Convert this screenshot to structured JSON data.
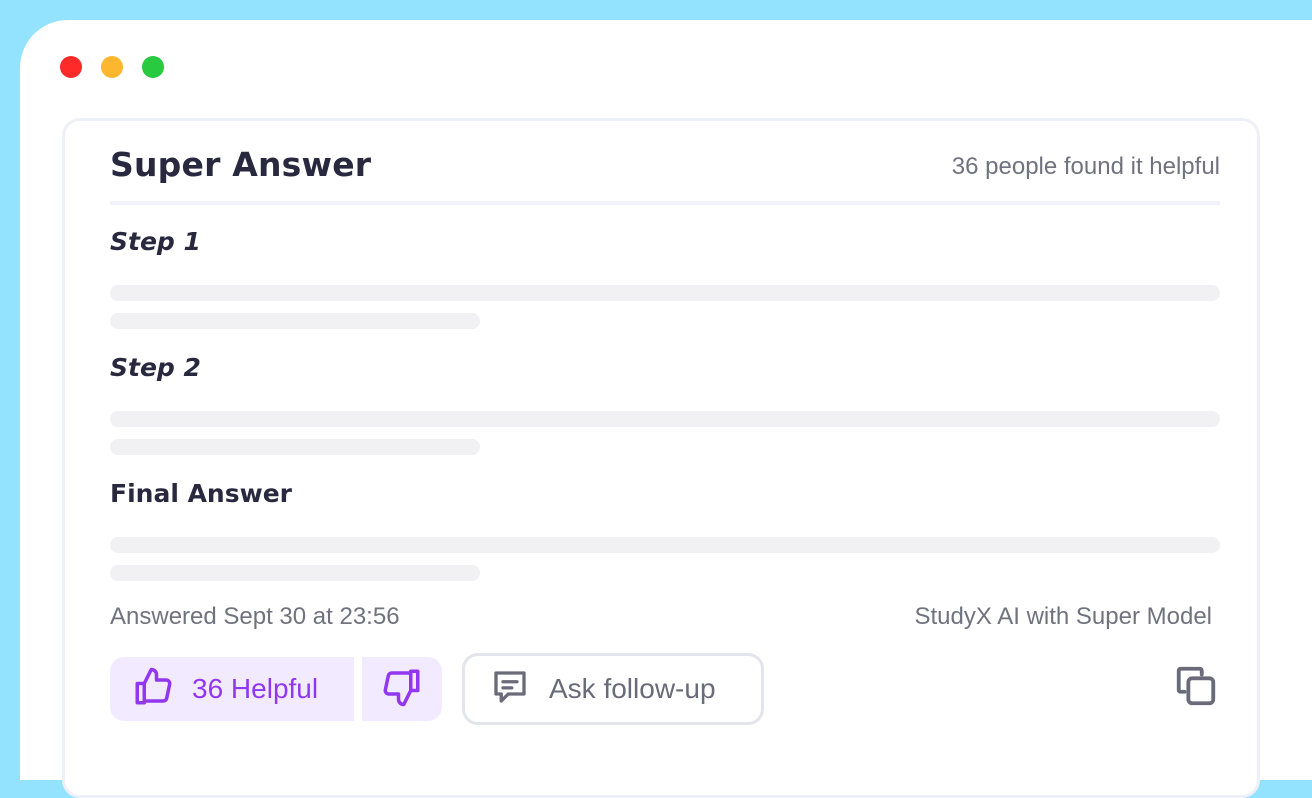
{
  "colors": {
    "background": "#94e3fe",
    "close_dot": "#fe2a2a",
    "minimize_dot": "#fcb72e",
    "maximize_dot": "#28ca3f",
    "accent": "#9237f0",
    "accent_bg": "#f2ebff",
    "text_dark": "#28283f",
    "text_muted": "#72727f",
    "placeholder_bar": "#f1f1f4"
  },
  "window": {
    "controls": [
      "close-dot",
      "minimize-dot",
      "maximize-dot"
    ]
  },
  "answer": {
    "title": "Super Answer",
    "helpful_count_text": "36 people found it helpful",
    "sections": [
      {
        "title": "Step 1"
      },
      {
        "title": "Step 2"
      },
      {
        "title": "Final Answer"
      }
    ],
    "answered_at": "Answered Sept 30 at 23:56",
    "model": "StudyX AI with Super Model"
  },
  "actions": {
    "helpful_label": "36 Helpful",
    "helpful_icon": "thumbs-up-icon",
    "unhelpful_icon": "thumbs-down-icon",
    "ask_label": "Ask follow-up",
    "ask_icon": "chat-bubble-icon",
    "copy_icon": "copy-icon"
  }
}
